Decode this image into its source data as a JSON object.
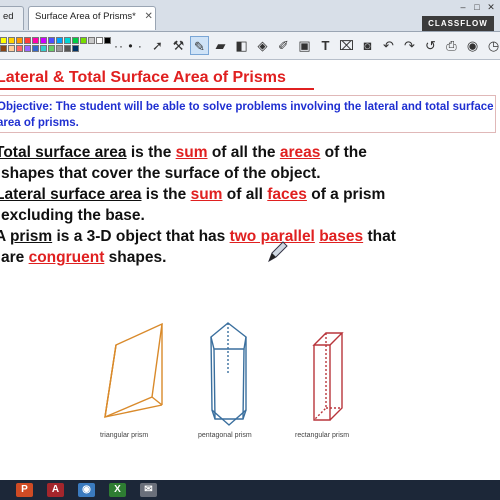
{
  "tabs": [
    {
      "label": "ed",
      "active": false
    },
    {
      "label": "Surface Area of Prisms*",
      "active": true
    }
  ],
  "window_controls": {
    "minimize": "–",
    "maximize": "□",
    "close": "✕"
  },
  "brand": "CLASSFLOW",
  "toolbar": {
    "palette": [
      "#ffff00",
      "#ffd200",
      "#ff9900",
      "#ff3b3b",
      "#ff00aa",
      "#cc00ff",
      "#4f4fff",
      "#00a2ff",
      "#00d5d5",
      "#00cc44",
      "#77dd00",
      "#c9c9c9",
      "#ffffff",
      "#000000",
      "#8b4513",
      "#ffcc99",
      "#ff6666",
      "#9966ff",
      "#3366cc",
      "#33cccc",
      "#66cc66",
      "#999999",
      "#555555",
      "#003366"
    ],
    "dots": "·· • ·",
    "tools": [
      "arrow-tool-icon",
      "tools-icon",
      "pen-icon",
      "highlighter-icon",
      "eraser-icon",
      "fill-icon",
      "marker-icon",
      "shape-icon",
      "text-icon",
      "rubber-icon",
      "screen-icon",
      "undo-icon",
      "redo-icon",
      "back-icon",
      "print-icon",
      "camera-icon",
      "clock-icon"
    ]
  },
  "heading": "Lateral & Total Surface Area of Prisms",
  "objective": "Objective: The student will be able to solve problems involving the lateral and total surface area of prisms.",
  "definitions": {
    "l1": [
      "Total surface area",
      " is the ",
      "sum",
      " of all the ",
      "areas",
      " of the"
    ],
    "l2": "shapes that cover the surface of the object.",
    "l3": [
      "Lateral surface area",
      " is the ",
      "sum",
      " of all ",
      "faces",
      " of a prism"
    ],
    "l4": "excluding the base.",
    "l5": [
      "A ",
      "prism",
      " is a 3-D object that has ",
      "two parallel",
      " ",
      "bases",
      " that"
    ],
    "l6": [
      "are ",
      "congruent",
      " shapes."
    ]
  },
  "figure": {
    "captions": [
      "triangular prism",
      "pentagonal prism",
      "rectangular prism"
    ],
    "colors": {
      "triangular": "#d98a2b",
      "pentagonal": "#3a6f9e",
      "rectangular": "#b8353b"
    }
  },
  "taskbar": {
    "icons": [
      "P",
      "A",
      "◉",
      "X",
      "✉"
    ]
  }
}
